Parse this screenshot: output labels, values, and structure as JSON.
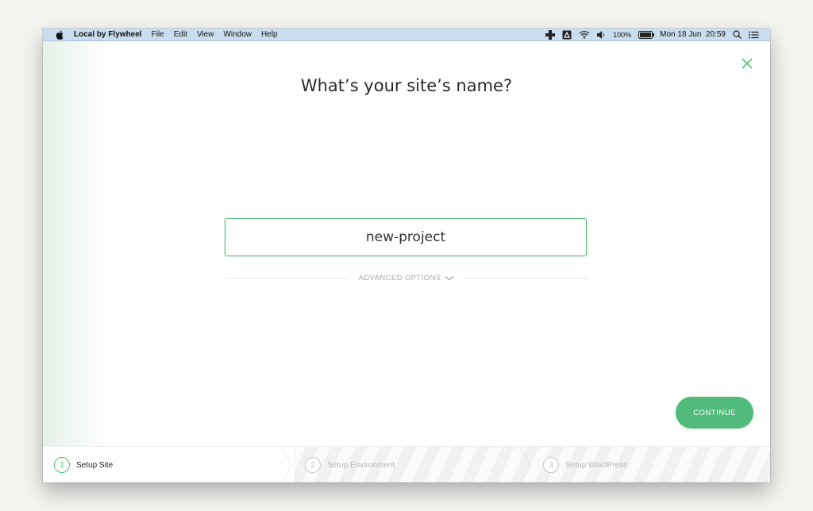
{
  "menubar": {
    "app_name": "Local by Flywheel",
    "menus": [
      "File",
      "Edit",
      "View",
      "Window",
      "Help"
    ],
    "battery": "100%",
    "datetime": "Mon 18 Jun  20:59"
  },
  "wizard": {
    "title": "What’s your site’s name?",
    "site_name_value": "new-project",
    "advanced_options_label": "ADVANCED OPTIONS",
    "continue_label": "CONTINUE"
  },
  "steps": [
    {
      "number": "1",
      "label": "Setup Site",
      "state": "active"
    },
    {
      "number": "2",
      "label": "Setup Environment",
      "state": "inactive"
    },
    {
      "number": "3",
      "label": "Setup WordPress",
      "state": "inactive"
    }
  ],
  "colors": {
    "accent": "#51bb7b",
    "menubar": "#c9dcf0"
  }
}
